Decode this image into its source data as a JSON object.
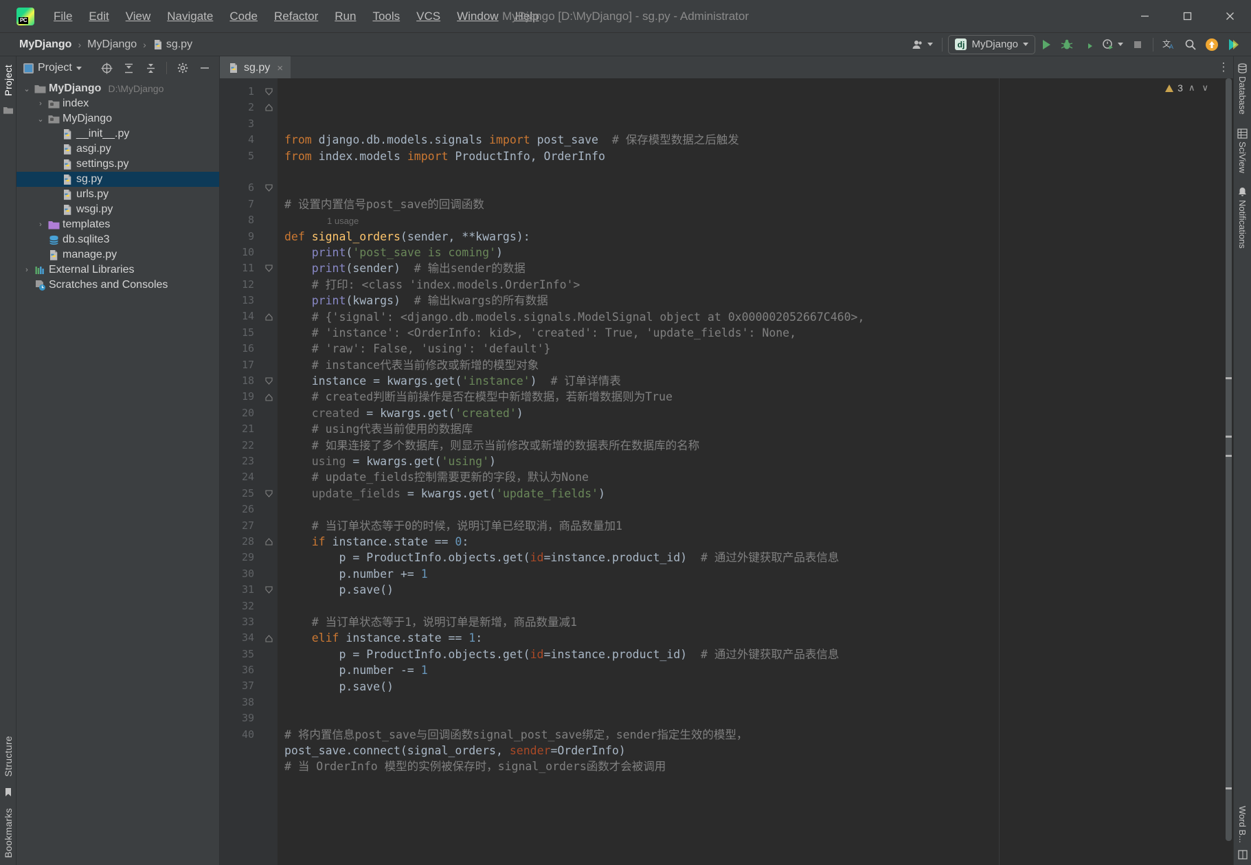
{
  "window": {
    "title": "MyDjango [D:\\MyDjango] - sg.py - Administrator",
    "minimize": "—",
    "maximize": "▢",
    "close": "✕"
  },
  "menu": [
    {
      "label": "File"
    },
    {
      "label": "Edit"
    },
    {
      "label": "View"
    },
    {
      "label": "Navigate"
    },
    {
      "label": "Code"
    },
    {
      "label": "Refactor"
    },
    {
      "label": "Run"
    },
    {
      "label": "Tools"
    },
    {
      "label": "VCS"
    },
    {
      "label": "Window"
    },
    {
      "label": "Help"
    }
  ],
  "breadcrumb": {
    "items": [
      "MyDjango",
      "MyDjango",
      "sg.py"
    ],
    "separator": "›"
  },
  "toolbar": {
    "run_config": "MyDjango",
    "icons": [
      "account-icon",
      "run-icon",
      "debug-icon",
      "run-coverage-icon",
      "profiler-icon",
      "stop-icon",
      "translate-icon",
      "search-icon",
      "update-icon",
      "ide-feature-icon"
    ]
  },
  "left_strip": {
    "top_label": "Project",
    "bottom_labels": [
      "Bookmarks",
      "Structure"
    ]
  },
  "project_panel": {
    "title": "Project",
    "tree": [
      {
        "depth": 0,
        "arrow": "⌄",
        "label": "MyDjango",
        "path": "D:\\MyDjango",
        "icon": "folder-icon",
        "bold": true,
        "selected": false
      },
      {
        "depth": 1,
        "arrow": "›",
        "label": "index",
        "path": "",
        "icon": "module-folder-icon",
        "bold": false,
        "selected": false
      },
      {
        "depth": 1,
        "arrow": "⌄",
        "label": "MyDjango",
        "path": "",
        "icon": "module-folder-icon",
        "bold": false,
        "selected": false
      },
      {
        "depth": 2,
        "arrow": "",
        "label": "__init__.py",
        "path": "",
        "icon": "python-file-icon",
        "bold": false,
        "selected": false
      },
      {
        "depth": 2,
        "arrow": "",
        "label": "asgi.py",
        "path": "",
        "icon": "python-file-icon",
        "bold": false,
        "selected": false
      },
      {
        "depth": 2,
        "arrow": "",
        "label": "settings.py",
        "path": "",
        "icon": "python-file-icon",
        "bold": false,
        "selected": false
      },
      {
        "depth": 2,
        "arrow": "",
        "label": "sg.py",
        "path": "",
        "icon": "python-file-icon",
        "bold": false,
        "selected": true
      },
      {
        "depth": 2,
        "arrow": "",
        "label": "urls.py",
        "path": "",
        "icon": "python-file-icon",
        "bold": false,
        "selected": false
      },
      {
        "depth": 2,
        "arrow": "",
        "label": "wsgi.py",
        "path": "",
        "icon": "python-file-icon",
        "bold": false,
        "selected": false
      },
      {
        "depth": 1,
        "arrow": "›",
        "label": "templates",
        "path": "",
        "icon": "templates-folder-icon",
        "bold": false,
        "selected": false
      },
      {
        "depth": 1,
        "arrow": "",
        "label": "db.sqlite3",
        "path": "",
        "icon": "database-file-icon",
        "bold": false,
        "selected": false
      },
      {
        "depth": 1,
        "arrow": "",
        "label": "manage.py",
        "path": "",
        "icon": "python-file-icon",
        "bold": false,
        "selected": false
      },
      {
        "depth": 0,
        "arrow": "›",
        "label": "External Libraries",
        "path": "",
        "icon": "libraries-icon",
        "bold": false,
        "selected": false
      },
      {
        "depth": 0,
        "arrow": "",
        "label": "Scratches and Consoles",
        "path": "",
        "icon": "scratches-icon",
        "bold": false,
        "selected": false
      }
    ]
  },
  "editor": {
    "tab": {
      "label": "sg.py",
      "close": "×"
    },
    "inspection": {
      "count": "3",
      "up": "∧",
      "down": "∨"
    },
    "usage_hint": "1 usage",
    "lines": [
      {
        "n": 1,
        "fold": "start",
        "html": "<span class='kw'>from</span> django.db.models.signals <span class='kw'>import</span> post_save  <span class='cm'># 保存模型数据之后触发</span>"
      },
      {
        "n": 2,
        "fold": "end",
        "html": "<span class='kw'>from</span> index.models <span class='kw'>import</span> ProductInfo, OrderInfo"
      },
      {
        "n": 3,
        "fold": "",
        "html": ""
      },
      {
        "n": 4,
        "fold": "",
        "html": ""
      },
      {
        "n": 5,
        "fold": "",
        "html": "<span class='cm'># 设置内置信号post_save的回调函数</span>"
      },
      {
        "n": "",
        "fold": "",
        "usage": true,
        "html": "1 usage"
      },
      {
        "n": 6,
        "fold": "start",
        "html": "<span class='kw'>def</span> <span class='fn'>signal_orders</span>(sender, **kwargs):"
      },
      {
        "n": 7,
        "fold": "",
        "html": "    <span class='bi'>print</span>(<span class='str'>'post_save is coming'</span>)"
      },
      {
        "n": 8,
        "fold": "",
        "html": "    <span class='bi'>print</span>(sender)  <span class='cm'># 输出sender的数据</span>"
      },
      {
        "n": 9,
        "fold": "",
        "html": "    <span class='cm'># 打印: &lt;class 'index.models.OrderInfo'&gt;</span>"
      },
      {
        "n": 10,
        "fold": "",
        "html": "    <span class='bi'>print</span>(kwargs)  <span class='cm'># 输出kwargs的所有数据</span>"
      },
      {
        "n": 11,
        "fold": "start",
        "html": "    <span class='cm'># {'signal': &lt;django.db.models.signals.ModelSignal object at 0x000002052667C460&gt;,</span>"
      },
      {
        "n": 12,
        "fold": "",
        "html": "    <span class='cm'># 'instance': &lt;OrderInfo: kid&gt;, 'created': True, 'update_fields': None,</span>"
      },
      {
        "n": 13,
        "fold": "",
        "html": "    <span class='cm'># 'raw': False, 'using': 'default'}</span>"
      },
      {
        "n": 14,
        "fold": "end",
        "html": "    <span class='cm'># instance代表当前修改或新增的模型对象</span>"
      },
      {
        "n": 15,
        "fold": "",
        "html": "    instance = kwargs.get(<span class='str'>'instance'</span>)  <span class='cm'># 订单详情表</span>"
      },
      {
        "n": 16,
        "fold": "",
        "html": "    <span class='cm'># created判断当前操作是否在模型中新增数据，若新增数据则为True</span>"
      },
      {
        "n": 17,
        "fold": "",
        "html": "    <span class='dim'>created</span> = kwargs.get(<span class='str'>'created'</span>)"
      },
      {
        "n": 18,
        "fold": "start",
        "html": "    <span class='cm'># using代表当前使用的数据库</span>"
      },
      {
        "n": 19,
        "fold": "end",
        "html": "    <span class='cm'># 如果连接了多个数据库，则显示当前修改或新增的数据表所在数据库的名称</span>"
      },
      {
        "n": 20,
        "fold": "",
        "html": "    <span class='dim'>using</span> = kwargs.get(<span class='str'>'using'</span>)"
      },
      {
        "n": 21,
        "fold": "",
        "html": "    <span class='cm'># update_fields控制需要更新的字段，默认为None</span>"
      },
      {
        "n": 22,
        "fold": "",
        "html": "    <span class='dim'>update_fields</span> = kwargs.get(<span class='str'>'update_fields'</span>)"
      },
      {
        "n": 23,
        "fold": "",
        "html": ""
      },
      {
        "n": 24,
        "fold": "",
        "html": "    <span class='cm'># 当订单状态等于0的时候，说明订单已经取消，商品数量加1</span>"
      },
      {
        "n": 25,
        "fold": "start",
        "html": "    <span class='kw'>if</span> instance.state == <span class='num'>0</span>:"
      },
      {
        "n": 26,
        "fold": "",
        "html": "        p = ProductInfo.objects.get(<span class='param'>id</span>=instance.product_id)  <span class='cm'># 通过外键获取产品表信息</span>"
      },
      {
        "n": 27,
        "fold": "",
        "html": "        p.number += <span class='num'>1</span>"
      },
      {
        "n": 28,
        "fold": "end",
        "html": "        p.save()"
      },
      {
        "n": 29,
        "fold": "",
        "html": ""
      },
      {
        "n": 30,
        "fold": "",
        "html": "    <span class='cm'># 当订单状态等于1，说明订单是新增，商品数量减1</span>"
      },
      {
        "n": 31,
        "fold": "start",
        "html": "    <span class='kw'>elif</span> instance.state == <span class='num'>1</span>:"
      },
      {
        "n": 32,
        "fold": "",
        "html": "        p = ProductInfo.objects.get(<span class='param'>id</span>=instance.product_id)  <span class='cm'># 通过外键获取产品表信息</span>"
      },
      {
        "n": 33,
        "fold": "",
        "html": "        p.number -= <span class='num'>1</span>"
      },
      {
        "n": 34,
        "fold": "end",
        "html": "        p.save()"
      },
      {
        "n": 35,
        "fold": "",
        "html": ""
      },
      {
        "n": 36,
        "fold": "",
        "html": ""
      },
      {
        "n": 37,
        "fold": "",
        "html": "<span class='cm'># 将内置信息post_save与回调函数signal_post_save绑定，sender指定生效的模型，</span>"
      },
      {
        "n": 38,
        "fold": "",
        "html": "post_save.connect(signal_orders, <span class='param'>sender</span>=OrderInfo)"
      },
      {
        "n": 39,
        "fold": "",
        "html": "<span class='cm'># 当 OrderInfo 模型的实例被保存时，signal_orders函数才会被调用</span>"
      },
      {
        "n": 40,
        "fold": "",
        "html": ""
      }
    ]
  },
  "right_strip": {
    "items": [
      "Database",
      "SciView",
      "Notifications"
    ],
    "bottom_items": [
      "Word B..."
    ]
  },
  "colors": {
    "accent_blue": "#0d3a58",
    "editor_bg": "#2b2b2b",
    "panel_bg": "#3c3f41",
    "comment": "#808080",
    "keyword": "#cc7832",
    "string": "#6a8759",
    "number": "#6897bb",
    "function": "#ffc66d",
    "warn": "#c9a34e"
  }
}
